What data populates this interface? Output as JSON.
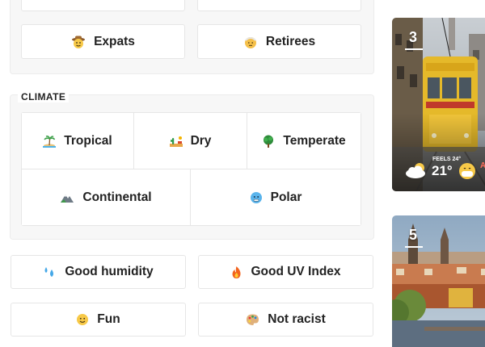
{
  "audience": {
    "items": [
      {
        "label": "Expats",
        "icon": "cowboy-face-icon"
      },
      {
        "label": "Retirees",
        "icon": "older-person-icon"
      }
    ]
  },
  "climate": {
    "section_label": "CLIMATE",
    "items": [
      {
        "label": "Tropical",
        "icon": "desert-island-icon"
      },
      {
        "label": "Dry",
        "icon": "desert-icon"
      },
      {
        "label": "Temperate",
        "icon": "deciduous-tree-icon"
      },
      {
        "label": "Continental",
        "icon": "mountain-icon"
      },
      {
        "label": "Polar",
        "icon": "cold-face-icon"
      }
    ]
  },
  "filters": {
    "items": [
      {
        "label": "Good humidity",
        "icon": "sweat-droplets-icon"
      },
      {
        "label": "Good UV Index",
        "icon": "fire-icon"
      },
      {
        "label": "Fun",
        "icon": "smiling-face-icon"
      },
      {
        "label": "Not racist",
        "icon": "artist-palette-icon"
      }
    ]
  },
  "cards": [
    {
      "rank": "3",
      "weather": {
        "feels_label": "FEELS 24°",
        "temperature": "21°",
        "weather_icon": "sun-behind-cloud-icon",
        "air_quality_icon": "face-with-mask-icon",
        "air_quality_text": "A"
      }
    },
    {
      "rank": "5"
    }
  ]
}
